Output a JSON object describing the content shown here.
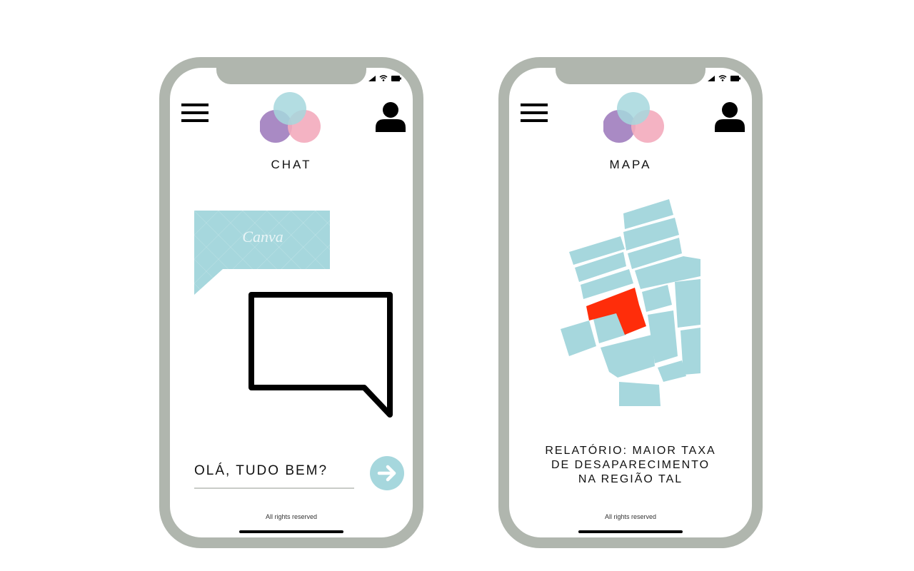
{
  "screens": [
    {
      "id": "chat",
      "title": "CHAT",
      "canva_watermark": "Canva",
      "message_input": {
        "value": "OLÁ, TUDO BEM?"
      },
      "send_icon": "arrow-right-icon",
      "footer": "All rights reserved"
    },
    {
      "id": "mapa",
      "title": "MAPA",
      "report_lines": [
        "RELATÓRIO: MAIOR TAXA",
        "DE DESAPARECIMENTO",
        "NA REGIÃO TAL"
      ],
      "footer": "All rights reserved"
    }
  ],
  "icons": {
    "menu": "hamburger-menu-icon",
    "profile": "user-icon",
    "logo": "three-circles-logo",
    "status": [
      "signal-icon",
      "wifi-icon",
      "battery-icon"
    ]
  },
  "colors": {
    "phone_frame": "#b0b6ae",
    "accent_teal": "#a6d7dd",
    "logo_purple": "#a98ac4",
    "logo_pink": "#f3abbc",
    "logo_teal": "#a6d7dd",
    "highlight_red": "#ff2d0a"
  }
}
